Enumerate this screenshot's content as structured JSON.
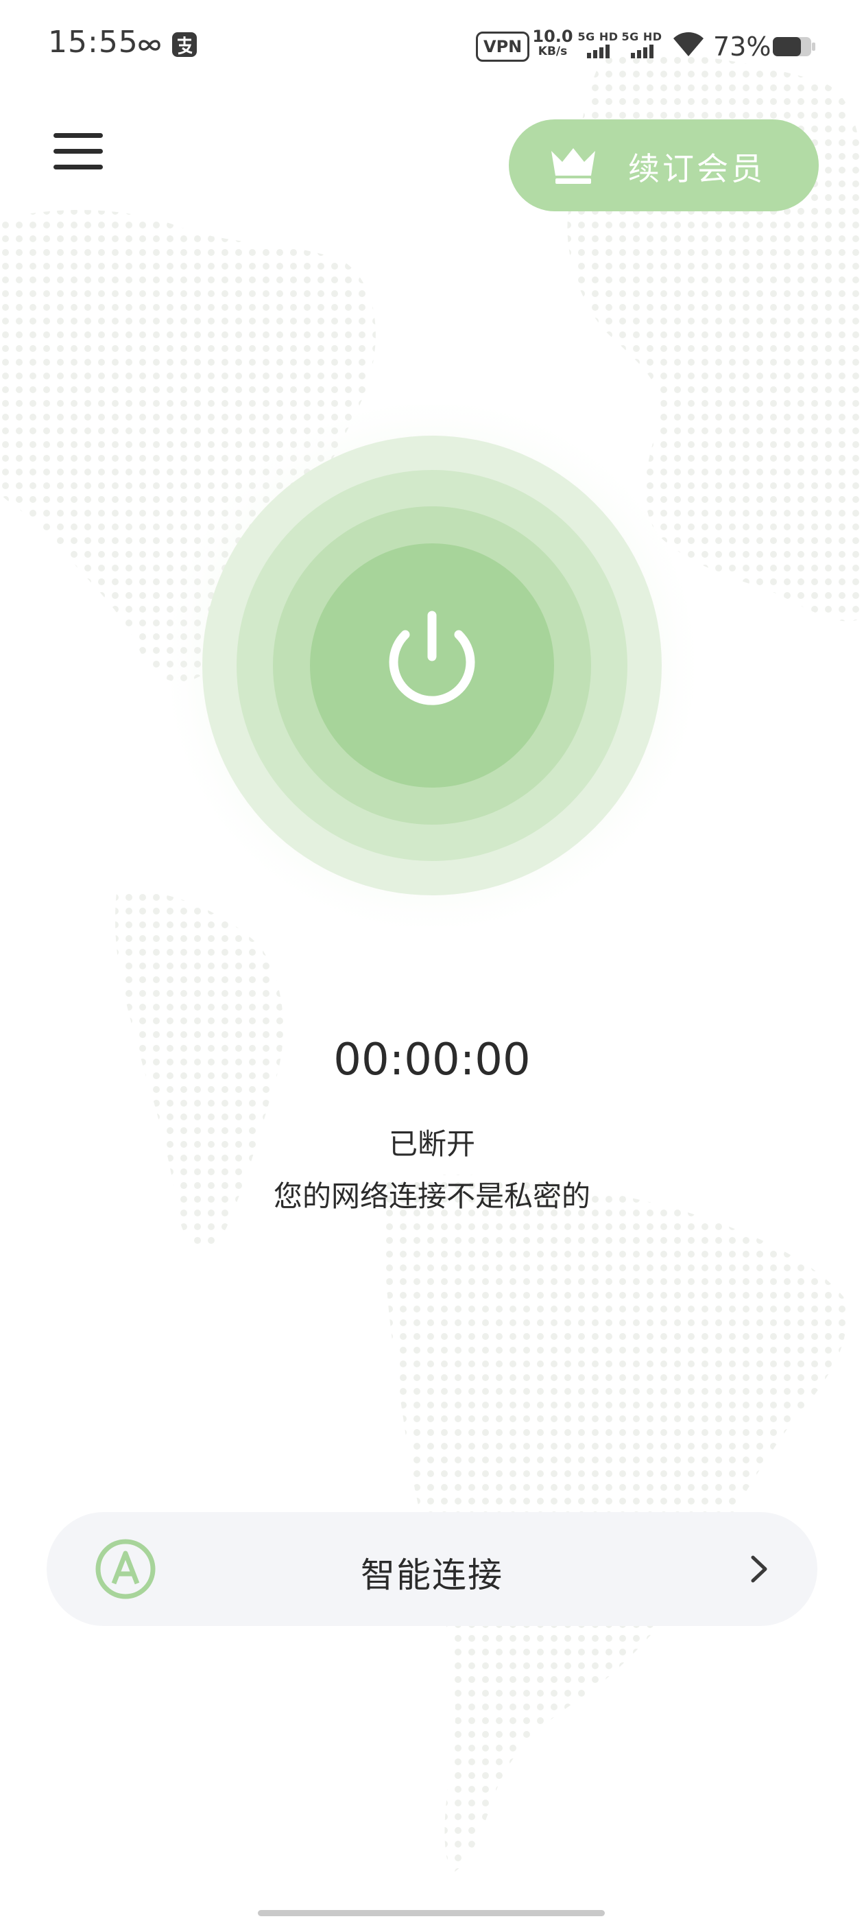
{
  "status_bar": {
    "time": "15:55",
    "vpn": "VPN",
    "net_speed_value": "10.0",
    "net_speed_unit": "KB/s",
    "sim1_label": "5G HD",
    "sim2_label": "5G HD",
    "battery": "73%",
    "battery_level": 0.73,
    "icons": [
      "link-icon",
      "alipay-icon",
      "wifi-icon",
      "battery-icon"
    ]
  },
  "header": {
    "menu_icon": "hamburger-menu-icon",
    "renew_button": {
      "label": "续订会员",
      "icon": "crown-icon"
    }
  },
  "power": {
    "icon": "power-icon"
  },
  "connection": {
    "timer": "00:00:00",
    "status": "已断开",
    "warning": "您的网络连接不是私密的"
  },
  "smart_connect": {
    "label": "智能连接",
    "icon": "auto-a-icon",
    "chevron": "chevron-right-icon"
  },
  "colors": {
    "accent": "#a7d49a",
    "accent_light": "#b2dba5",
    "bar_background": "#f4f5f8",
    "text": "#2b2b2b"
  }
}
